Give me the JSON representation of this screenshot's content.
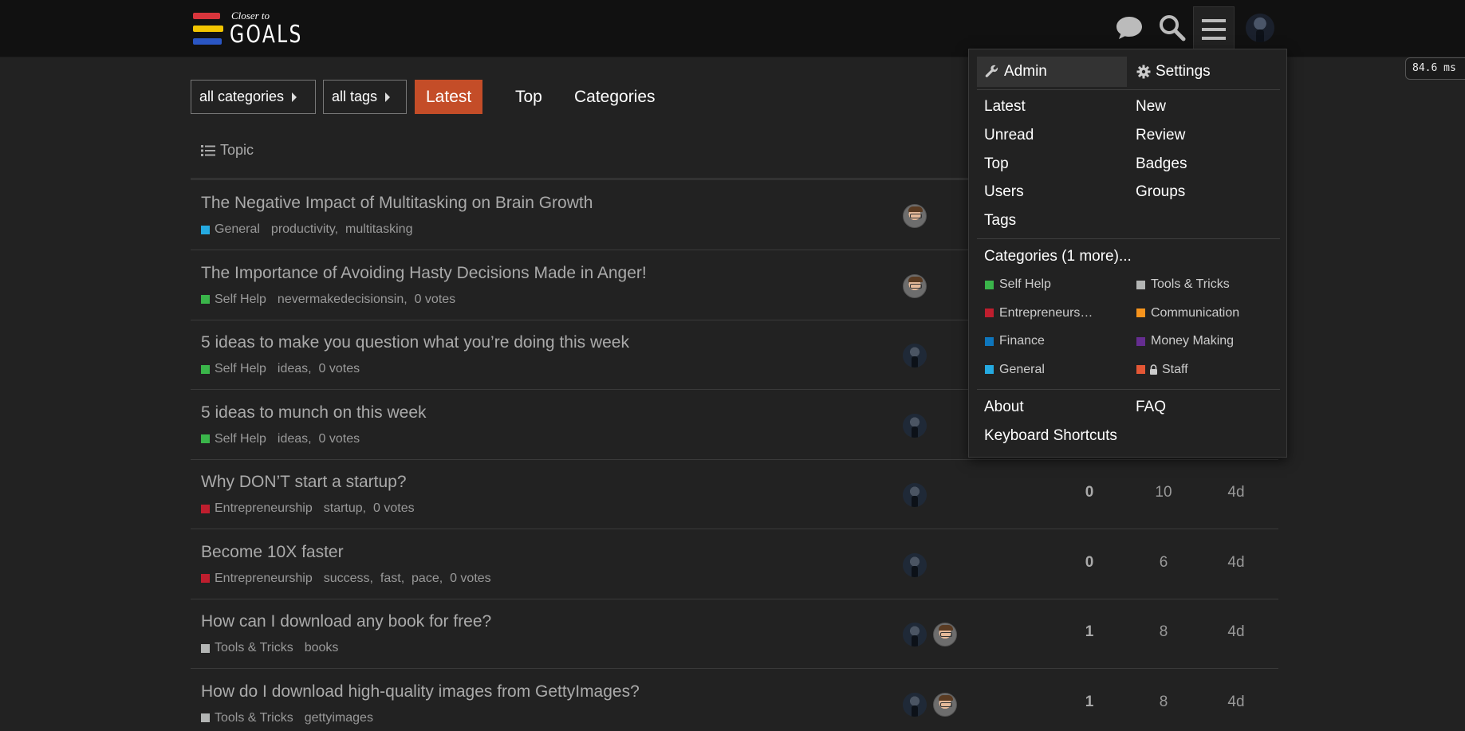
{
  "brand": {
    "line1": "Closer to",
    "line2": "GOALS"
  },
  "header_icons": [
    "chat-icon",
    "search-icon",
    "hamburger-menu-icon",
    "user-avatar"
  ],
  "timer": "84.6 ms",
  "nav": {
    "categories_dropdown": "all categories",
    "tags_dropdown": "all tags",
    "tabs": [
      "Latest",
      "Top",
      "Categories"
    ],
    "active_tab": "Latest"
  },
  "table": {
    "topic_header": "Topic"
  },
  "topics": [
    {
      "title": "The Negative Impact of Multitasking on Brain Growth",
      "category": "General",
      "category_color": "#25aae1",
      "tags": [
        "productivity",
        "multitasking"
      ],
      "posters": [
        "face"
      ],
      "replies": "",
      "views": "",
      "activity": ""
    },
    {
      "title": "The Importance of Avoiding Hasty Decisions Made in Anger!",
      "category": "Self Help",
      "category_color": "#3ab54a",
      "tags": [
        "nevermakedecisionsin",
        "0 votes"
      ],
      "posters": [
        "face"
      ],
      "replies": "",
      "views": "",
      "activity": ""
    },
    {
      "title": "5 ideas to make you question what you’re doing this week",
      "category": "Self Help",
      "category_color": "#3ab54a",
      "tags": [
        "ideas",
        "0 votes"
      ],
      "posters": [
        "dark"
      ],
      "replies": "",
      "views": "",
      "activity": ""
    },
    {
      "title": "5 ideas to munch on this week",
      "category": "Self Help",
      "category_color": "#3ab54a",
      "tags": [
        "ideas",
        "0 votes"
      ],
      "posters": [
        "dark"
      ],
      "replies": "",
      "views": "",
      "activity": ""
    },
    {
      "title": "Why DON’T start a startup?",
      "category": "Entrepreneurship",
      "category_color": "#bf1e2e",
      "tags": [
        "startup",
        "0 votes"
      ],
      "posters": [
        "dark"
      ],
      "replies": "0",
      "views": "10",
      "activity": "4d"
    },
    {
      "title": "Become 10X faster",
      "category": "Entrepreneurship",
      "category_color": "#bf1e2e",
      "tags": [
        "success",
        "fast",
        "pace",
        "0 votes"
      ],
      "posters": [
        "dark"
      ],
      "replies": "0",
      "views": "6",
      "activity": "4d"
    },
    {
      "title": "How can I download any book for free?",
      "category": "Tools & Tricks",
      "category_color": "#b3b5b4",
      "tags": [
        "books"
      ],
      "posters": [
        "dark",
        "face"
      ],
      "replies": "1",
      "views": "8",
      "activity": "4d"
    },
    {
      "title": "How do I download high-quality images from GettyImages?",
      "category": "Tools & Tricks",
      "category_color": "#b3b5b4",
      "tags": [
        "gettyimages"
      ],
      "posters": [
        "dark",
        "face"
      ],
      "replies": "1",
      "views": "8",
      "activity": "4d"
    }
  ],
  "menu": {
    "admin": "Admin",
    "settings": "Settings",
    "links_left": [
      "Latest",
      "Unread",
      "Top",
      "Users",
      "Tags"
    ],
    "links_right": [
      "New",
      "Review",
      "Badges",
      "Groups"
    ],
    "categories_label": "Categories (1 more)...",
    "categories": [
      {
        "name": "Self Help",
        "color": "#3ab54a"
      },
      {
        "name": "Tools & Tricks",
        "color": "#b3b5b4"
      },
      {
        "name": "Entrepreneurs…",
        "color": "#bf1e2e"
      },
      {
        "name": "Communication",
        "color": "#f7941d"
      },
      {
        "name": "Finance",
        "color": "#0e76bd"
      },
      {
        "name": "Money Making",
        "color": "#652d90"
      },
      {
        "name": "General",
        "color": "#25aae1"
      },
      {
        "name": "Staff",
        "color": "#e45735"
      }
    ],
    "footer_left": [
      "About",
      "Keyboard Shortcuts"
    ],
    "footer_right": [
      "FAQ"
    ]
  }
}
